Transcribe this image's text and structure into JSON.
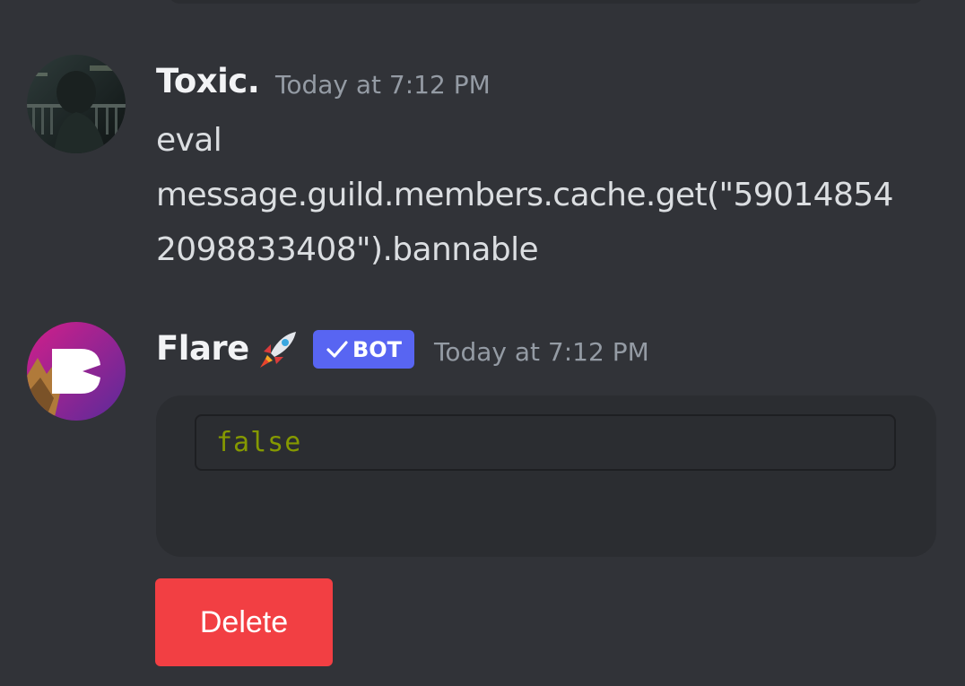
{
  "messages": [
    {
      "author": "Toxic.",
      "timestamp": "Today at 7:12 PM",
      "avatar_icon": "anime-avatar-icon",
      "content_lines": [
        "eval",
        "message.guild.members.cache.get(\"59014854",
        "2098833408\").bannable"
      ]
    },
    {
      "author": "Flare",
      "author_emoji": "rocket-emoji",
      "bot_badge": "BOT",
      "timestamp": "Today at 7:12 PM",
      "avatar_icon": "flare-logo-icon",
      "embed": {
        "code": "false"
      },
      "button": {
        "label": "Delete",
        "color": "#f23f43"
      }
    }
  ],
  "colors": {
    "background": "#313338",
    "embed": "#2b2d31",
    "bot_badge": "#5865f2",
    "code_text": "#859900"
  }
}
